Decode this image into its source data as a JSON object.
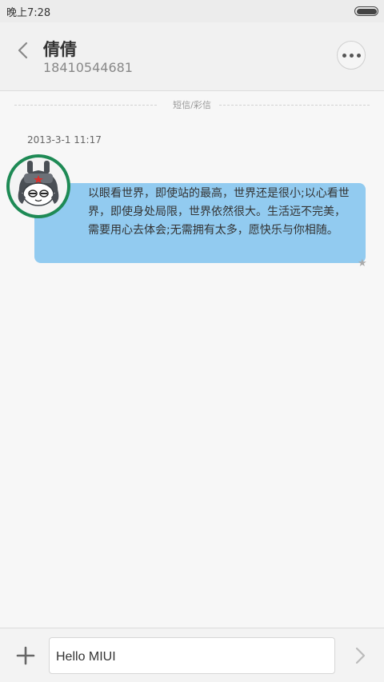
{
  "status_bar": {
    "time": "晚上7:28"
  },
  "header": {
    "contact_name": "倩倩",
    "contact_number": "18410544681",
    "back_icon": "back-chevron-icon",
    "more_icon": "more-dots-icon"
  },
  "conversation": {
    "divider_label": "短信/彩信",
    "timestamp": "2013-3-1 11:17",
    "message_text": "以眼看世界，即使站的最高，世界还是很小;以心看世界，即使身处局限，世界依然很大。生活远不完美，需要用心去体会;无需拥有太多，愿快乐与你相随。",
    "bubble_color": "#92cbf0",
    "avatar_ring_color": "#1e8a55",
    "star_icon": "star-icon"
  },
  "composer": {
    "input_value": "Hello MIUI",
    "add_icon": "plus-icon",
    "send_icon": "send-chevron-icon"
  }
}
